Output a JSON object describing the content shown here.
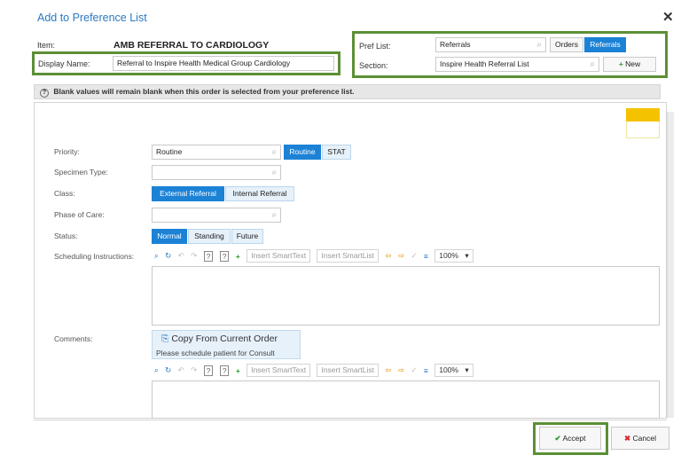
{
  "dialog": {
    "title": "Add to Preference List",
    "close_glyph": "✕"
  },
  "item": {
    "label": "Item:",
    "value": "AMB REFERRAL TO CARDIOLOGY"
  },
  "display_name": {
    "label": "Display Name:",
    "value": "Referral to Inspire Health Medical Group Cardiology"
  },
  "pref_list": {
    "label": "Pref List:",
    "value": "Referrals",
    "options": [
      "Orders",
      "Referrals"
    ],
    "selected": "Referrals"
  },
  "section": {
    "label": "Section:",
    "value": "Inspire Health Referral List",
    "new_button": "New"
  },
  "banner": {
    "icon": "?",
    "text": "Blank values will remain blank when this order is selected from your preference list."
  },
  "form": {
    "priority": {
      "label": "Priority:",
      "value": "Routine",
      "options": [
        "Routine",
        "STAT"
      ],
      "selected": "Routine"
    },
    "specimen_type": {
      "label": "Specimen Type:",
      "value": ""
    },
    "class": {
      "label": "Class:",
      "options": [
        "External Referral",
        "Internal Referral"
      ],
      "selected": "External Referral"
    },
    "phase_of_care": {
      "label": "Phase of Care:",
      "value": ""
    },
    "status": {
      "label": "Status:",
      "options": [
        "Normal",
        "Standing",
        "Future"
      ],
      "selected": "Normal"
    },
    "scheduling_instructions": {
      "label": "Scheduling Instructions:"
    },
    "comments": {
      "label": "Comments:",
      "copy_button": "Copy From Current Order",
      "copy_note": "Please schedule patient for Consult"
    }
  },
  "toolbar": {
    "insert_smarttext": "Insert SmartText",
    "insert_smartlist": "Insert SmartList",
    "zoom": "100%"
  },
  "footer": {
    "accept": "Accept",
    "cancel": "Cancel"
  },
  "colors": {
    "highlight_border": "#5c8f36",
    "selected_button": "#1b82d6",
    "title_blue": "#2a79c2"
  }
}
